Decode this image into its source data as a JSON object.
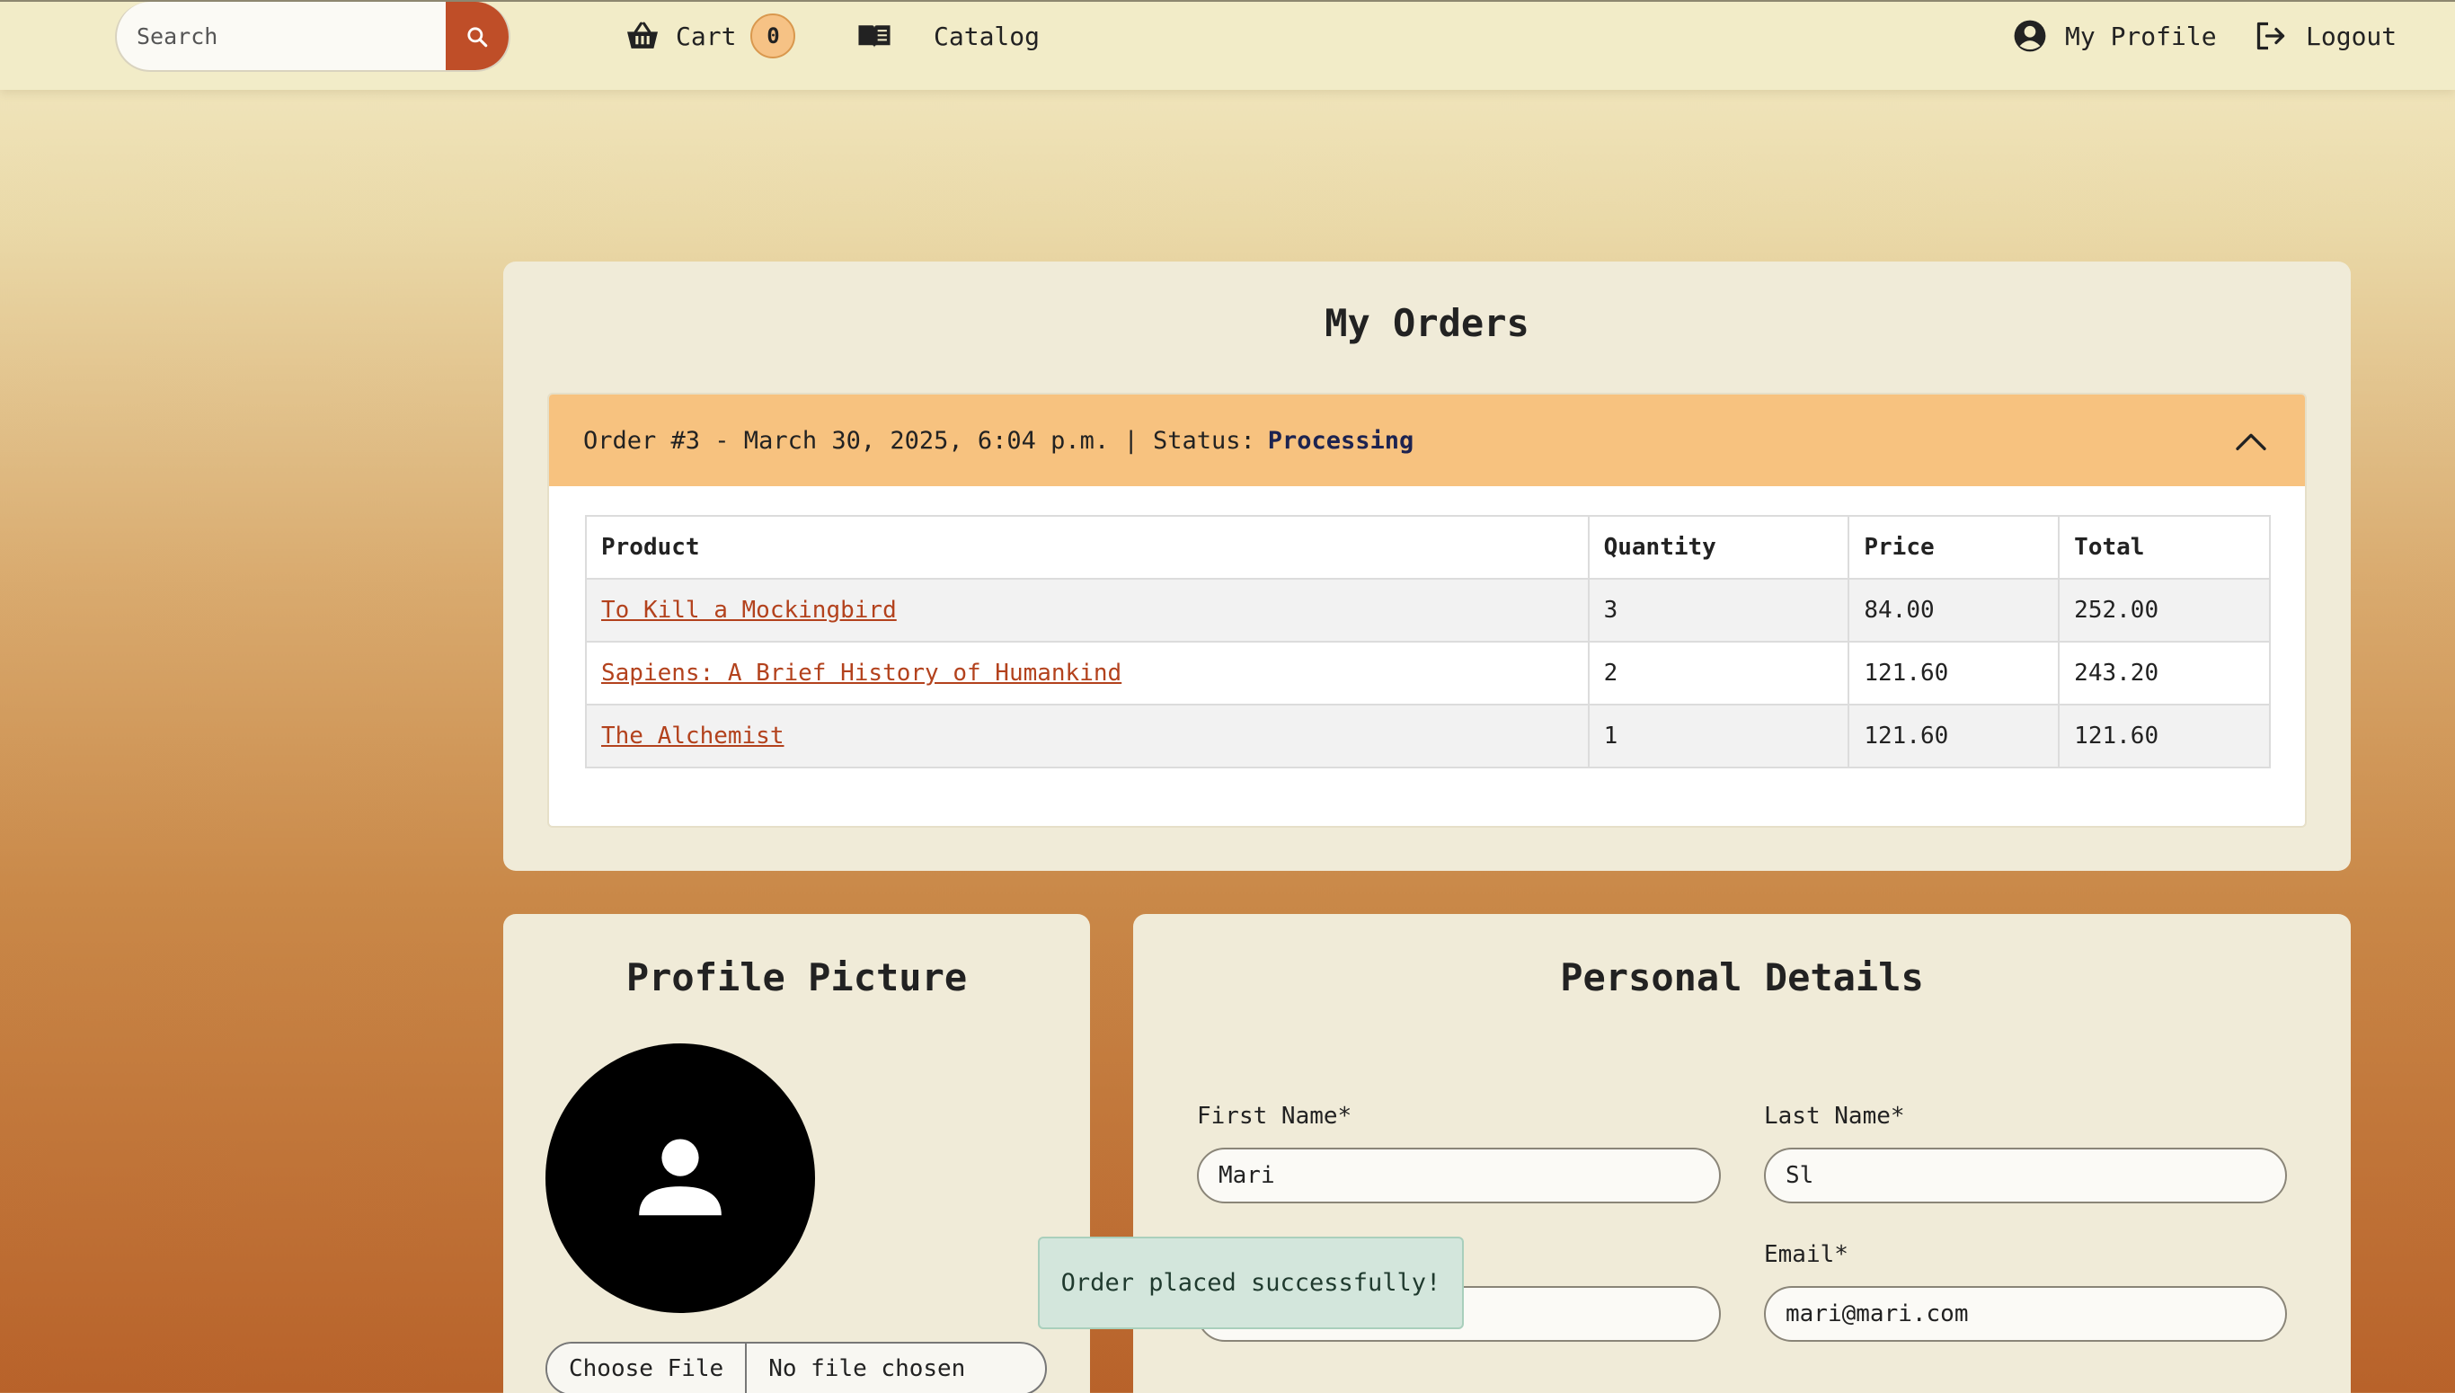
{
  "navbar": {
    "search_placeholder": "Search",
    "cart_label": "Cart",
    "cart_count": "0",
    "catalog_label": "Catalog",
    "profile_label": "My Profile",
    "logout_label": "Logout"
  },
  "orders": {
    "title": "My Orders",
    "order": {
      "header_text": "Order #3 - March 30, 2025, 6:04 p.m. | Status:",
      "status": "Processing",
      "columns": [
        "Product",
        "Quantity",
        "Price",
        "Total"
      ],
      "rows": [
        {
          "product": "To Kill a Mockingbird",
          "quantity": "3",
          "price": "84.00",
          "total": "252.00"
        },
        {
          "product": "Sapiens: A Brief History of Humankind",
          "quantity": "2",
          "price": "121.60",
          "total": "243.20"
        },
        {
          "product": "The Alchemist",
          "quantity": "1",
          "price": "121.60",
          "total": "121.60"
        }
      ]
    }
  },
  "profile_picture": {
    "title": "Profile Picture",
    "choose_file_label": "Choose File",
    "file_status": "No file chosen"
  },
  "personal_details": {
    "title": "Personal Details",
    "first_name_label": "First Name*",
    "first_name_value": "Mari",
    "last_name_label": "Last Name*",
    "last_name_value": "Sl",
    "email_label": "Email*",
    "email_value": "mari@mari.com"
  },
  "toast": {
    "message": "Order placed successfully!"
  },
  "colors": {
    "accent": "#bf4e28",
    "order_header": "#f7c27f",
    "link": "#b3421d"
  }
}
